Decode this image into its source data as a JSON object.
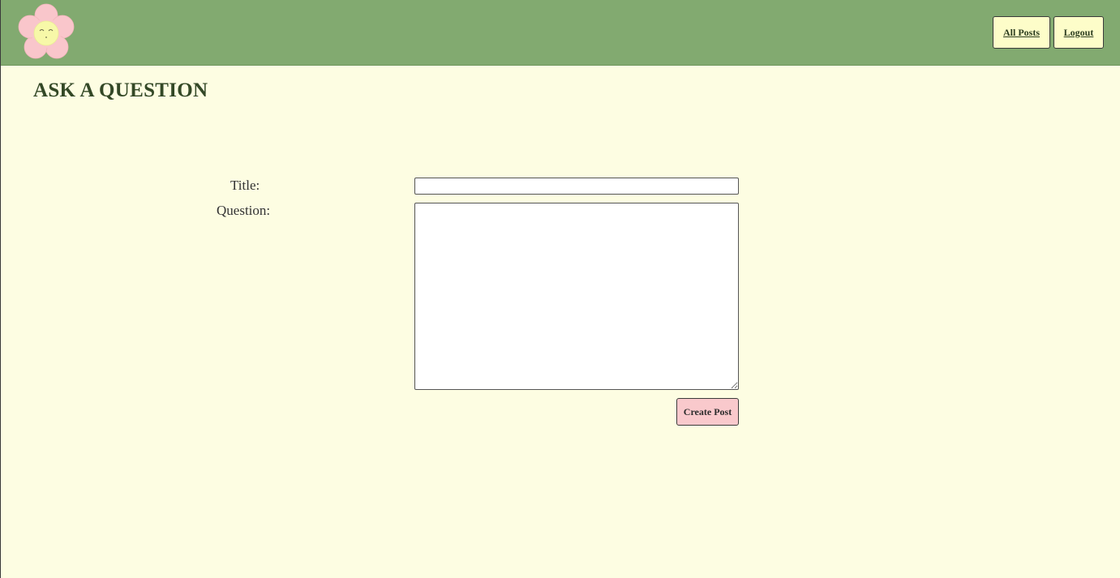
{
  "navbar": {
    "logo_icon": "smiling-flower-logo-icon",
    "all_posts_label": "All Posts",
    "logout_label": "Logout"
  },
  "page": {
    "title": "ASK A QUESTION"
  },
  "form": {
    "title_label": "Title:",
    "title_value": "",
    "question_label": "Question:",
    "question_value": "",
    "submit_label": "Create Post"
  },
  "colors": {
    "navbar_bg": "#82aa70",
    "page_bg": "#fdfde2",
    "nav_button_bg": "#fdfdc9",
    "submit_button_bg": "#f9c9cc",
    "heading": "#334826"
  }
}
